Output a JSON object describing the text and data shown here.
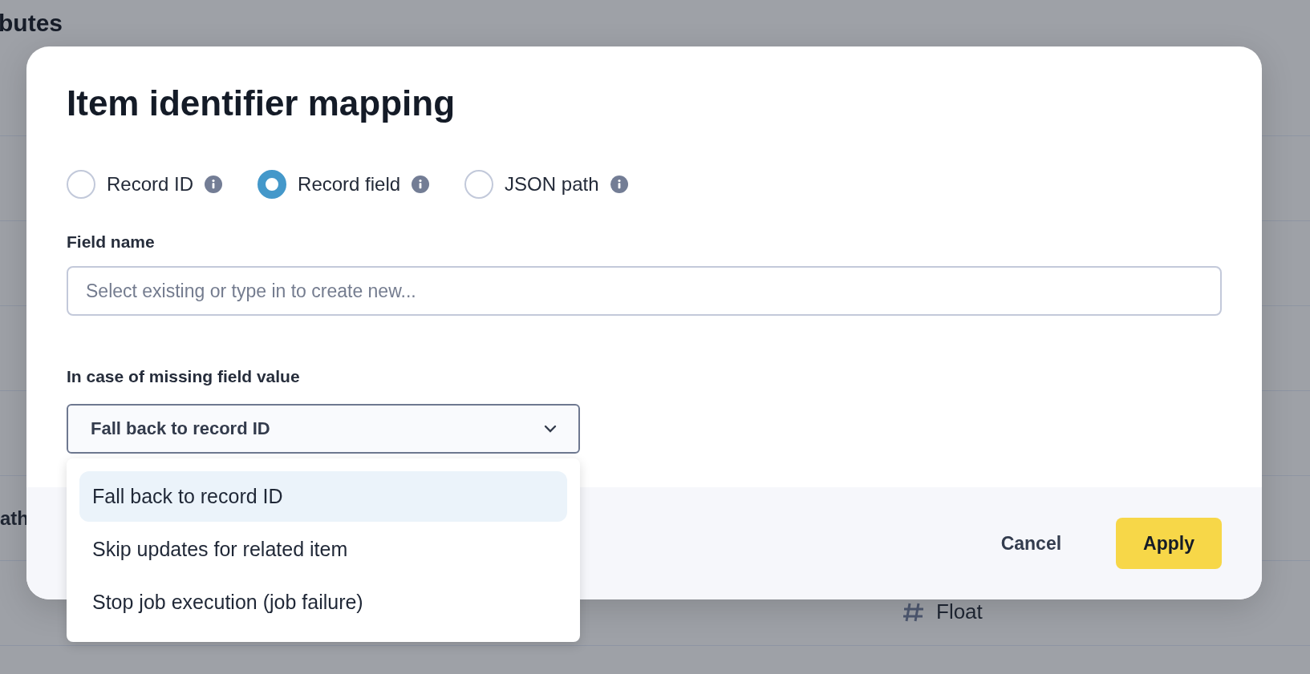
{
  "background": {
    "heading": "butes",
    "rows": [
      {
        "column_1": "ath"
      },
      {
        "column_2": "Float"
      }
    ]
  },
  "dialog": {
    "title": "Item identifier mapping",
    "options": [
      {
        "label": "Record ID",
        "selected": false
      },
      {
        "label": "Record field",
        "selected": true
      },
      {
        "label": "JSON path",
        "selected": false
      }
    ],
    "field_name": {
      "label": "Field name",
      "placeholder": "Select existing or type in to create new..."
    },
    "missing_value": {
      "label": "In case of missing field value",
      "value": "Fall back to record ID",
      "expanded": true,
      "options": [
        {
          "label": "Fall back to record ID",
          "selected": true
        },
        {
          "label": "Skip updates for related item",
          "selected": false
        },
        {
          "label": "Stop job execution (job failure)",
          "selected": false
        }
      ]
    },
    "buttons": [
      {
        "label": "Cancel",
        "kind": "secondary"
      },
      {
        "label": "Apply",
        "kind": "primary"
      }
    ]
  }
}
